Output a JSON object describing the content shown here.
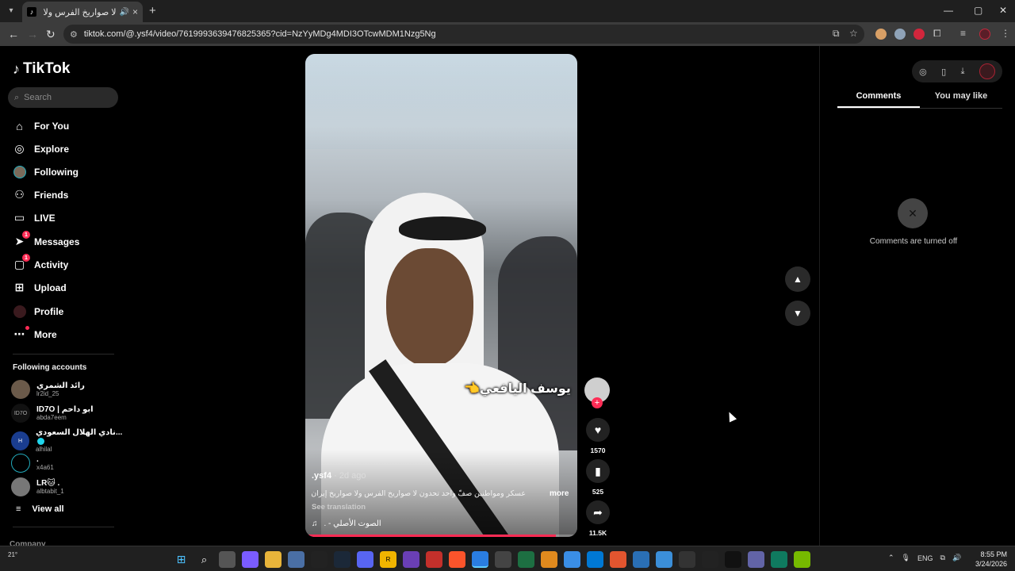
{
  "browser": {
    "tab_title": "لا صواريخ الفرس ولا صواريخ",
    "tab_close": "×",
    "new_tab": "+",
    "url": "tiktok.com/@.ysf4/video/7619993639476825365?cid=NzYyMDg4MDI3OTcwMDM1Nzg5Ng",
    "window_controls": [
      "—",
      "▢",
      "✕"
    ]
  },
  "tiktok": {
    "logo_text": "TikTok",
    "search_placeholder": "Search",
    "nav": [
      {
        "label": "For You",
        "icon": "home-icon"
      },
      {
        "label": "Explore",
        "icon": "compass-icon"
      },
      {
        "label": "Following",
        "icon": "following-avatar-icon"
      },
      {
        "label": "Friends",
        "icon": "friends-icon"
      },
      {
        "label": "LIVE",
        "icon": "live-icon"
      },
      {
        "label": "Messages",
        "icon": "messages-icon",
        "badge": "1"
      },
      {
        "label": "Activity",
        "icon": "activity-icon",
        "badge": "1"
      },
      {
        "label": "Upload",
        "icon": "upload-icon"
      },
      {
        "label": "Profile",
        "icon": "profile-avatar-icon"
      },
      {
        "label": "More",
        "icon": "more-icon"
      }
    ],
    "following_title": "Following accounts",
    "accounts": [
      {
        "name": "رائد الشمري",
        "handle": "lr2id_25"
      },
      {
        "name": "ID7O | ابو داحم",
        "handle": "abda7eem"
      },
      {
        "name": "نادي الهلال السعودي...",
        "handle": "alhilal",
        "verified": true
      },
      {
        "name": ".",
        "handle": "x4a61"
      },
      {
        "name": "LR🐱 .",
        "handle": "albtabit_1"
      }
    ],
    "view_all": "View all",
    "company": "Company"
  },
  "video": {
    "overlay_text": "يوسف اليافعي👈",
    "username": ".ysf4",
    "age": " · 2d ago",
    "caption": "عسكر ومواطنين صفّ واحد تحدون لا صواريخ الفرس ولا صواريخ إيران...",
    "more": "more",
    "see_translation": "See translation",
    "sound_icon": "♫",
    "sound": "الصوت الأصلي - .",
    "progress": 0.92
  },
  "actions": {
    "follow_plus": "+",
    "likes": "1570",
    "saves": "525",
    "shares": "11.5K"
  },
  "right_panel": {
    "tabs": [
      "Comments",
      "You may like"
    ],
    "comments_off": "Comments are turned off"
  },
  "taskbar": {
    "weather": "21°",
    "lang": "ENG",
    "time": "8:55 PM",
    "date": "3/24/2026"
  }
}
